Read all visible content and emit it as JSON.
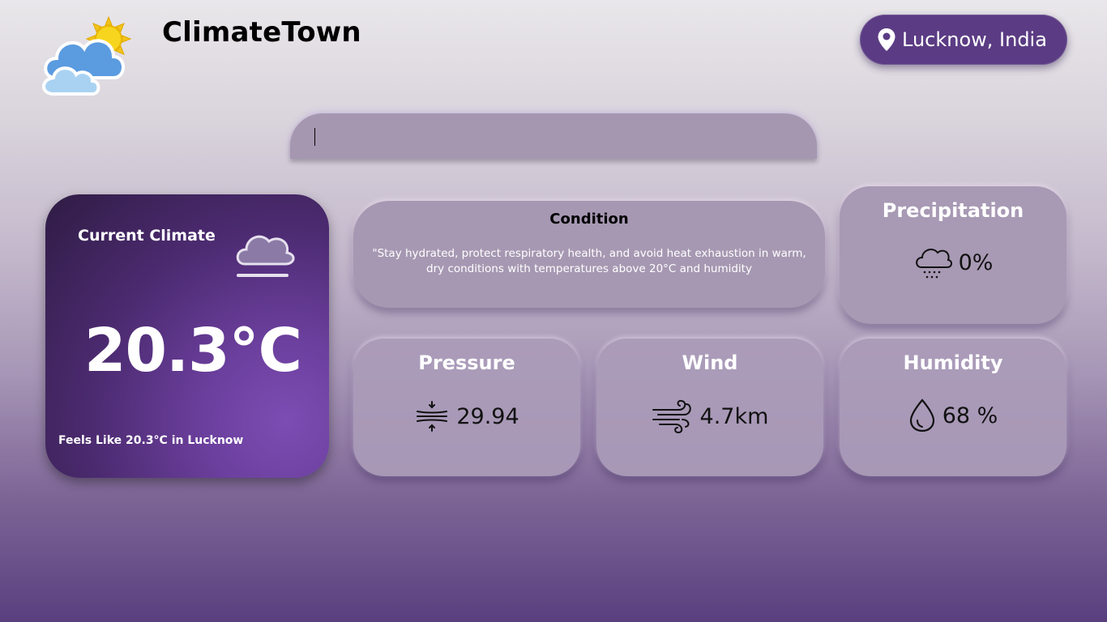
{
  "header": {
    "app_title": "ClimateTown",
    "logo_icon": "cloud-sun-icon",
    "location": "Lucknow, India",
    "location_icon": "map-pin-icon"
  },
  "search": {
    "value": "",
    "placeholder": ""
  },
  "current": {
    "label": "Current Climate",
    "icon": "cloud-fog-icon",
    "temperature": "20.3°C",
    "feels_like": "Feels Like 20.3°C in Lucknow"
  },
  "condition": {
    "title": "Condition",
    "description": "\"Stay hydrated, protect respiratory health, and avoid heat exhaustion in warm, dry conditions with temperatures above 20°C and humidity"
  },
  "precipitation": {
    "title": "Precipitation",
    "value": "0%",
    "icon": "cloud-rain-icon"
  },
  "pressure": {
    "title": "Pressure",
    "value": "29.94",
    "icon": "pressure-icon"
  },
  "wind": {
    "title": "Wind",
    "value": "4.7km",
    "icon": "wind-icon"
  },
  "humidity": {
    "title": "Humidity",
    "value": "68 %",
    "icon": "droplet-icon"
  },
  "colors": {
    "location_pill": "#5b3c84",
    "card": "#a698b2",
    "current_card": "#6b3f9d"
  }
}
